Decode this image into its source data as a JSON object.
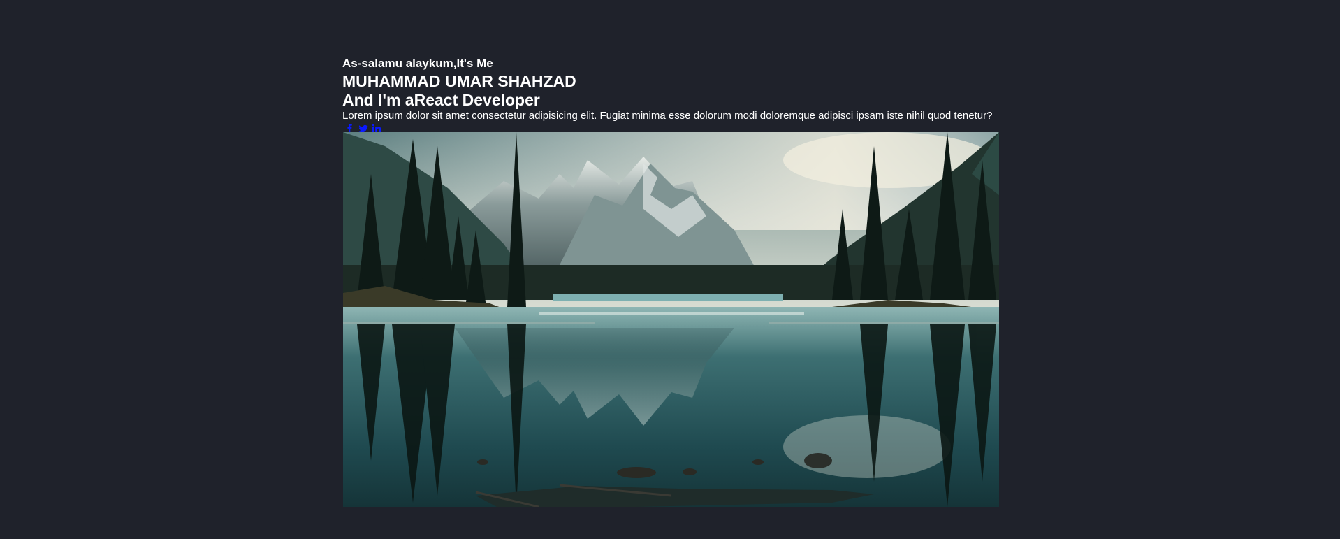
{
  "hero": {
    "greeting": "As-salamu alaykum,It's Me",
    "name": "MUHAMMAD UMAR SHAHZAD",
    "role_prefix": "And I'm a",
    "role": "React Developer",
    "description": "Lorem ipsum dolor sit amet consectetur adipisicing elit. Fugiat minima esse dolorum modi doloremque adipisci ipsam iste nihil quod tenetur?"
  },
  "socials": [
    {
      "icon": "facebook-icon"
    },
    {
      "icon": "twitter-icon"
    },
    {
      "icon": "linkedin-icon"
    }
  ],
  "image": {
    "subject": "mountain-lake-landscape"
  },
  "colors": {
    "background": "#1f222b",
    "text": "#ffffff",
    "social_icons": "#0a1aff"
  }
}
